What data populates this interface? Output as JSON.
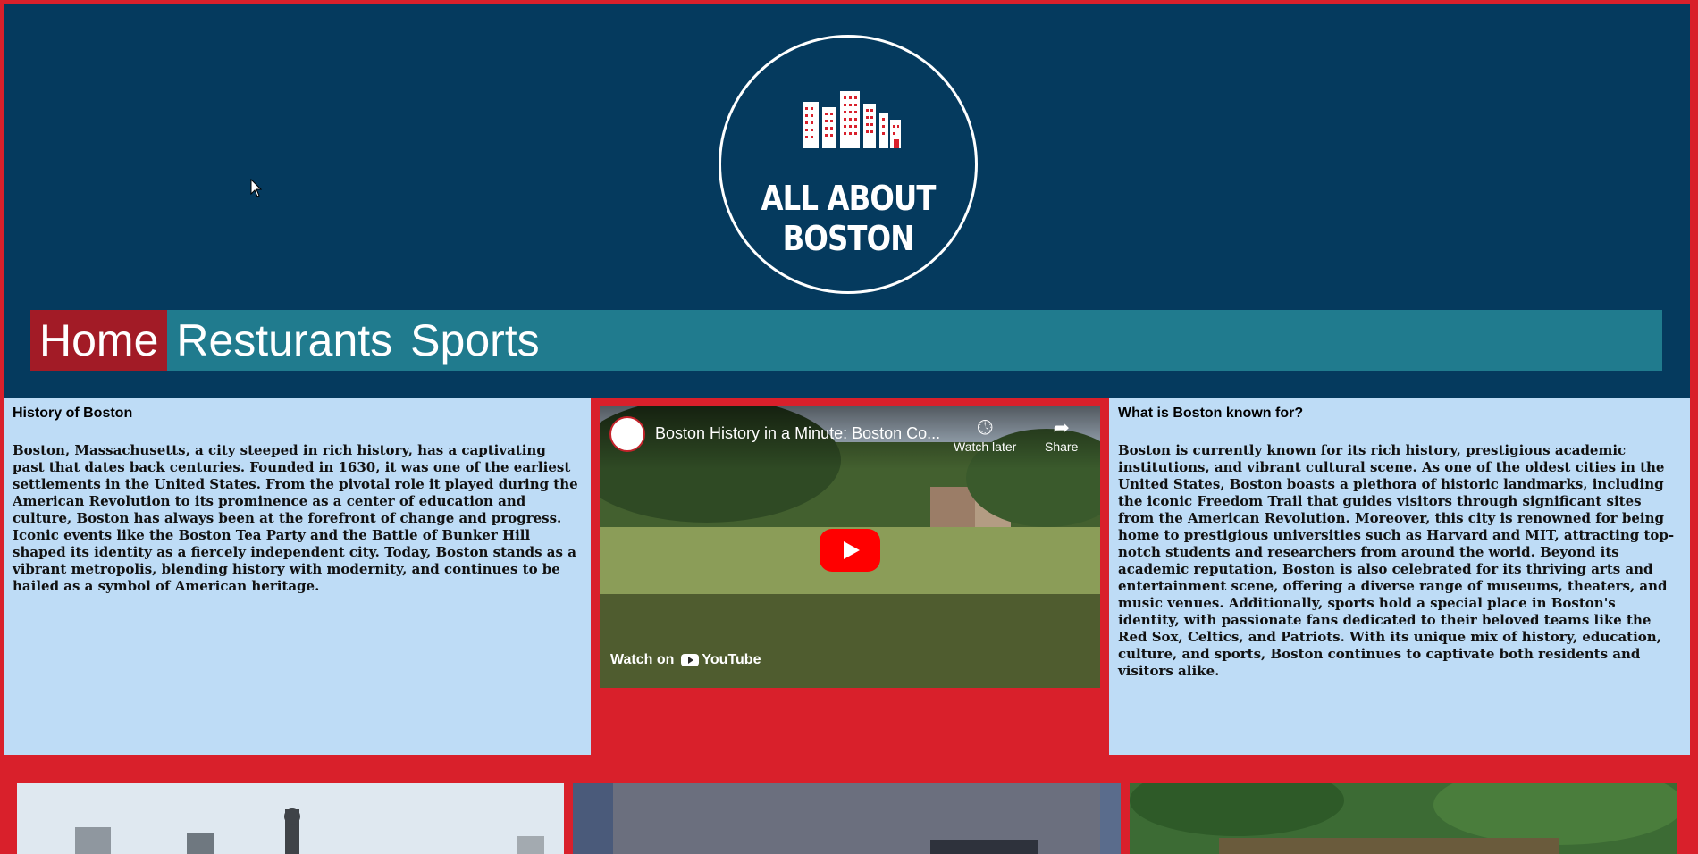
{
  "logo": {
    "line1": "ALL ABOUT",
    "line2": "BOSTON",
    "icon": "city-buildings-icon"
  },
  "nav": {
    "items": [
      {
        "label": "Home",
        "active": true
      },
      {
        "label": "Resturants",
        "active": false
      },
      {
        "label": "Sports",
        "active": false
      }
    ]
  },
  "history": {
    "heading": "History of Boston",
    "body": "Boston, Massachusetts, a city steeped in rich history, has a captivating past that dates back centuries. Founded in 1630, it was one of the earliest settlements in the United States. From the pivotal role it played during the American Revolution to its prominence as a center of education and culture, Boston has always been at the forefront of change and progress. Iconic events like the Boston Tea Party and the Battle of Bunker Hill shaped its identity as a fiercely independent city. Today, Boston stands as a vibrant metropolis, blending history with modernity, and continues to be hailed as a symbol of American heritage."
  },
  "video": {
    "title": "Boston History in a Minute: Boston Co...",
    "watch_later": "Watch later",
    "share": "Share",
    "watch_on": "Watch on",
    "youtube": "YouTube"
  },
  "known_for": {
    "heading": "What is Boston known for?",
    "body": "Boston is currently known for its rich history, prestigious academic institutions, and vibrant cultural scene. As one of the oldest cities in the United States, Boston boasts a plethora of historic landmarks, including the iconic Freedom Trail that guides visitors through significant sites from the American Revolution. Moreover, this city is renowned for being home to prestigious universities such as Harvard and MIT, attracting top-notch students and researchers from around the world. Beyond its academic reputation, Boston is also celebrated for its thriving arts and entertainment scene, offering a diverse range of museums, theaters, and music venues. Additionally, sports hold a special place in Boston's identity, with passionate fans dedicated to their beloved teams like the Red Sox, Celtics, and Patriots. With its unique mix of history, education, culture, and sports, Boston continues to captivate both residents and visitors alike."
  },
  "colors": {
    "page_bg": "#d9202b",
    "header_bg": "#053a5e",
    "nav_bg": "#207b8e",
    "nav_active": "#a21b26",
    "panel_bg": "#bedcf6"
  }
}
